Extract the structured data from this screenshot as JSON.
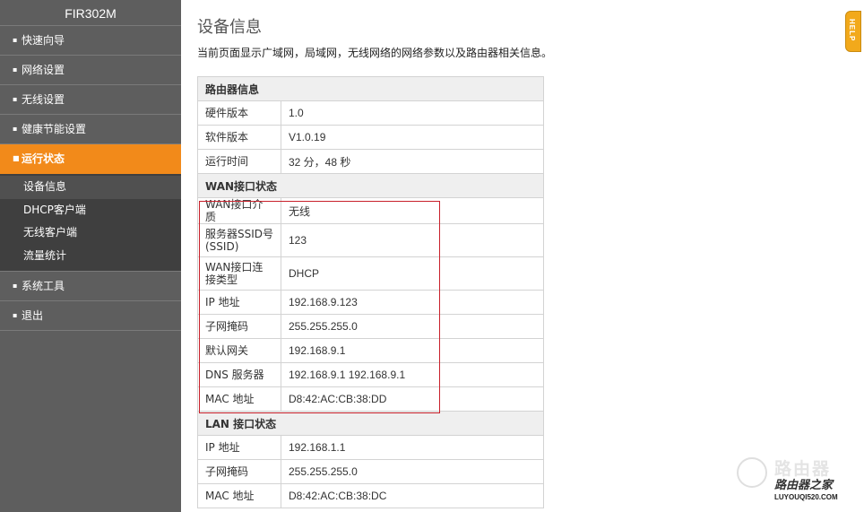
{
  "sidebar": {
    "model": "FIR302M",
    "items": [
      {
        "label": "快速向导"
      },
      {
        "label": "网络设置"
      },
      {
        "label": "无线设置"
      },
      {
        "label": "健康节能设置"
      },
      {
        "label": "运行状态"
      },
      {
        "label": "系统工具"
      },
      {
        "label": "退出"
      }
    ],
    "sub_items": [
      {
        "label": "设备信息"
      },
      {
        "label": "DHCP客户端"
      },
      {
        "label": "无线客户端"
      },
      {
        "label": "流量统计"
      }
    ]
  },
  "page": {
    "title": "设备信息",
    "description": "当前页面显示广域网，局域网，无线网络的网络参数以及路由器相关信息。"
  },
  "router_info": {
    "header": "路由器信息",
    "rows": [
      {
        "label": "硬件版本",
        "value": "1.0"
      },
      {
        "label": "软件版本",
        "value": "V1.0.19"
      },
      {
        "label": "运行时间",
        "value": "32 分，48 秒"
      }
    ]
  },
  "wan_status": {
    "header": "WAN接口状态",
    "rows": [
      {
        "label": "WAN接口介质",
        "value": "无线"
      },
      {
        "label": "服务器SSID号(SSID)",
        "value": "123"
      },
      {
        "label": "WAN接口连接类型",
        "value": "DHCP"
      },
      {
        "label": "IP 地址",
        "value": "192.168.9.123"
      },
      {
        "label": "子网掩码",
        "value": "255.255.255.0"
      },
      {
        "label": "默认网关",
        "value": "192.168.9.1"
      },
      {
        "label": "DNS 服务器",
        "value": "192.168.9.1 192.168.9.1"
      },
      {
        "label": "MAC 地址",
        "value": "D8:42:AC:CB:38:DD"
      }
    ]
  },
  "lan_status": {
    "header": "LAN 接口状态",
    "rows": [
      {
        "label": "IP 地址",
        "value": "192.168.1.1"
      },
      {
        "label": "子网掩码",
        "value": "255.255.255.0"
      },
      {
        "label": "MAC 地址",
        "value": "D8:42:AC:CB:38:DC"
      }
    ]
  },
  "help": {
    "label": "HELP",
    "icon": "help-tab"
  },
  "watermark": {
    "cn_gray": "路由器",
    "cn_dark": "路由器之家",
    "en": "LUYOUQI520.COM"
  },
  "colors": {
    "sidebar_bg": "#5e5e5e",
    "active_orange": "#f28a1a",
    "submenu_bg": "#3f3f3f",
    "highlight_red": "#c8202a",
    "help_orange": "#f2a91b"
  }
}
